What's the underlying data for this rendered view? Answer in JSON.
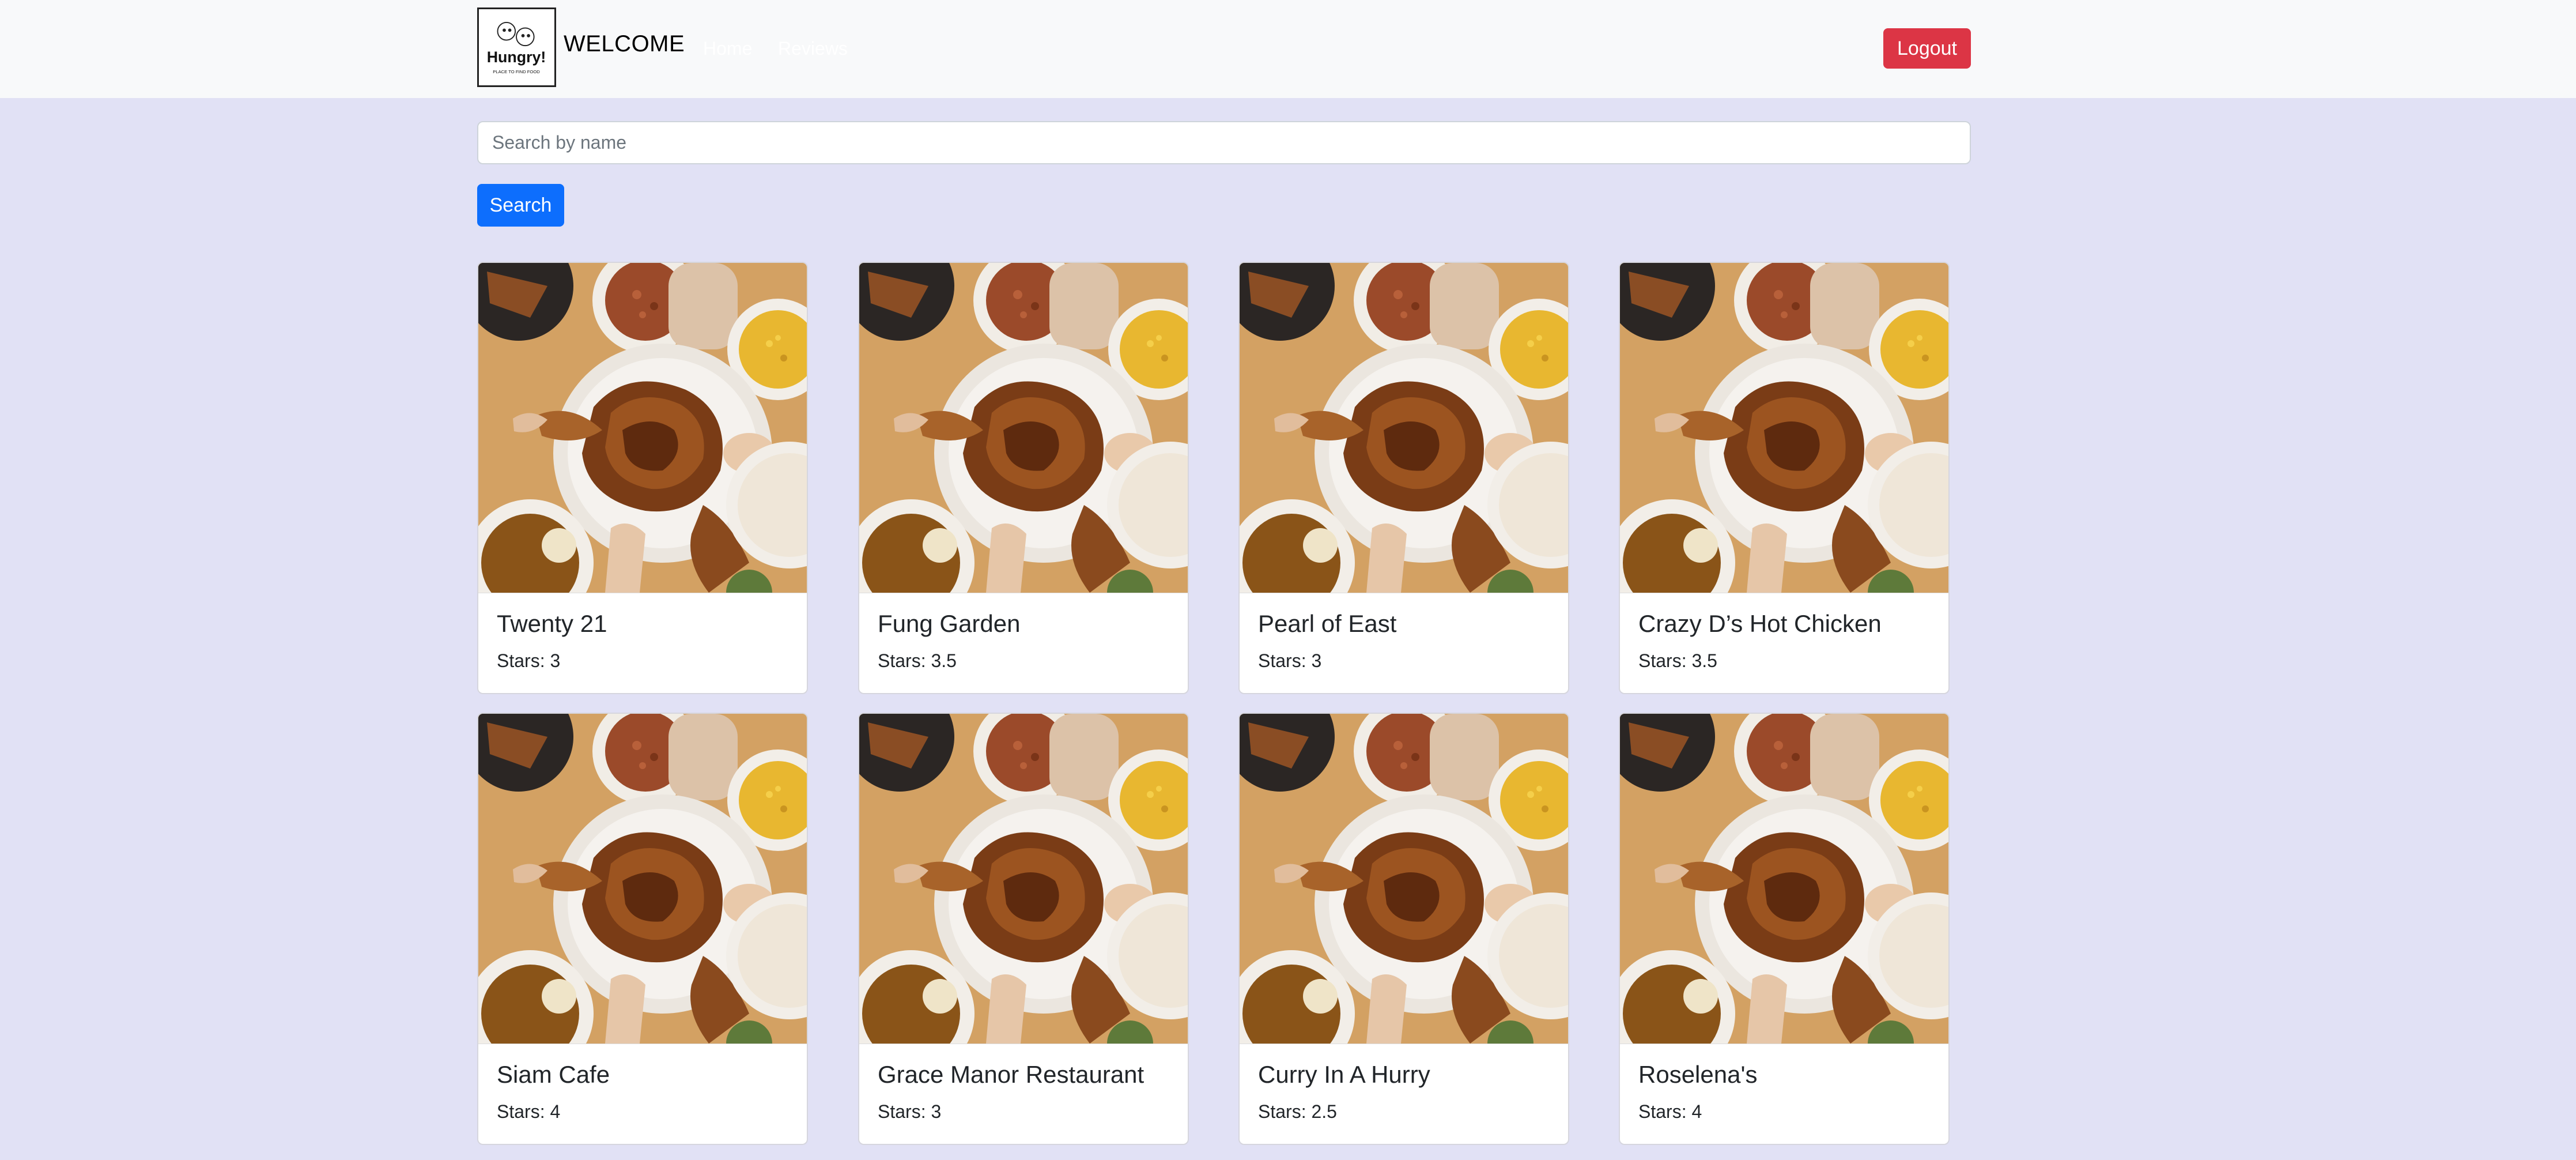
{
  "navbar": {
    "logo_text": "Hungry!",
    "logo_tagline": "PLACE TO FIND FOOD",
    "brand": "WELCOME",
    "links": [
      "Home",
      "Reviews"
    ],
    "logout_label": "Logout"
  },
  "search": {
    "placeholder": "Search by name",
    "value": "",
    "button_label": "Search"
  },
  "colors": {
    "page_background": "#e1e1f5",
    "logout": "#dc3545",
    "search_button": "#0d6efd"
  },
  "restaurants": [
    {
      "name": "Twenty 21",
      "stars": "Stars: 3"
    },
    {
      "name": "Fung Garden",
      "stars": "Stars: 3.5"
    },
    {
      "name": "Pearl of East",
      "stars": "Stars: 3"
    },
    {
      "name": "Crazy D’s Hot Chicken",
      "stars": "Stars: 3.5"
    },
    {
      "name": "Siam Cafe",
      "stars": "Stars: 4"
    },
    {
      "name": "Grace Manor Restaurant",
      "stars": "Stars: 3"
    },
    {
      "name": "Curry In A Hurry",
      "stars": "Stars: 2.5"
    },
    {
      "name": "Roselena's",
      "stars": "Stars: 4"
    }
  ]
}
